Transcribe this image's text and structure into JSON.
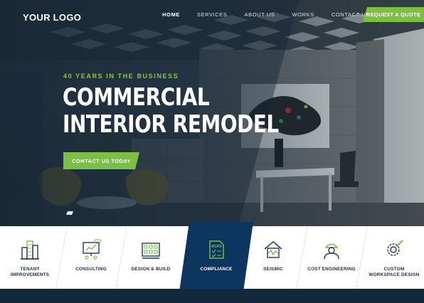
{
  "brand": {
    "logo": "YOUR LOGO"
  },
  "nav": {
    "items": [
      {
        "label": "HOME",
        "active": true
      },
      {
        "label": "SERVICES",
        "active": false
      },
      {
        "label": "ABOUT US",
        "active": false
      },
      {
        "label": "WORKS",
        "active": false
      },
      {
        "label": "CONTACT US",
        "active": false
      }
    ],
    "quote_button": "REQUEST A QUOTE"
  },
  "hero": {
    "tagline": "40 YEARS IN THE BUSINESS",
    "headline_line1": "COMMERCIAL",
    "headline_line2": "INTERIOR REMODEL",
    "cta": "CONTACT US TODAY",
    "slider_active_index": 0
  },
  "services": [
    {
      "label_line1": "TENANT",
      "label_line2": "IMPROVEMENTS",
      "icon": "buildings-icon"
    },
    {
      "label_line1": "CONSULTING",
      "label_line2": "",
      "icon": "presentation-board-icon"
    },
    {
      "label_line1": "DESIGN & BUILD",
      "label_line2": "",
      "icon": "blueprint-grid-icon"
    },
    {
      "label_line1": "COMPLIANCE",
      "label_line2": "",
      "icon": "rgpd-document-icon",
      "active": true,
      "badge": "RGPD"
    },
    {
      "label_line1": "SEISMIC",
      "label_line2": "",
      "icon": "house-seismic-icon"
    },
    {
      "label_line1": "COST ENGINEERING",
      "label_line2": "",
      "icon": "engineer-icon"
    },
    {
      "label_line1": "CUSTOM",
      "label_line2": "WORKSPACE DESIGN",
      "icon": "gear-pencil-icon"
    }
  ],
  "colors": {
    "accent_green": "#7ac143",
    "tagline_green": "#8cc63f",
    "active_navy": "#0c3560",
    "icon_green": "#7ac143",
    "icon_navy": "#1e3a5a"
  }
}
